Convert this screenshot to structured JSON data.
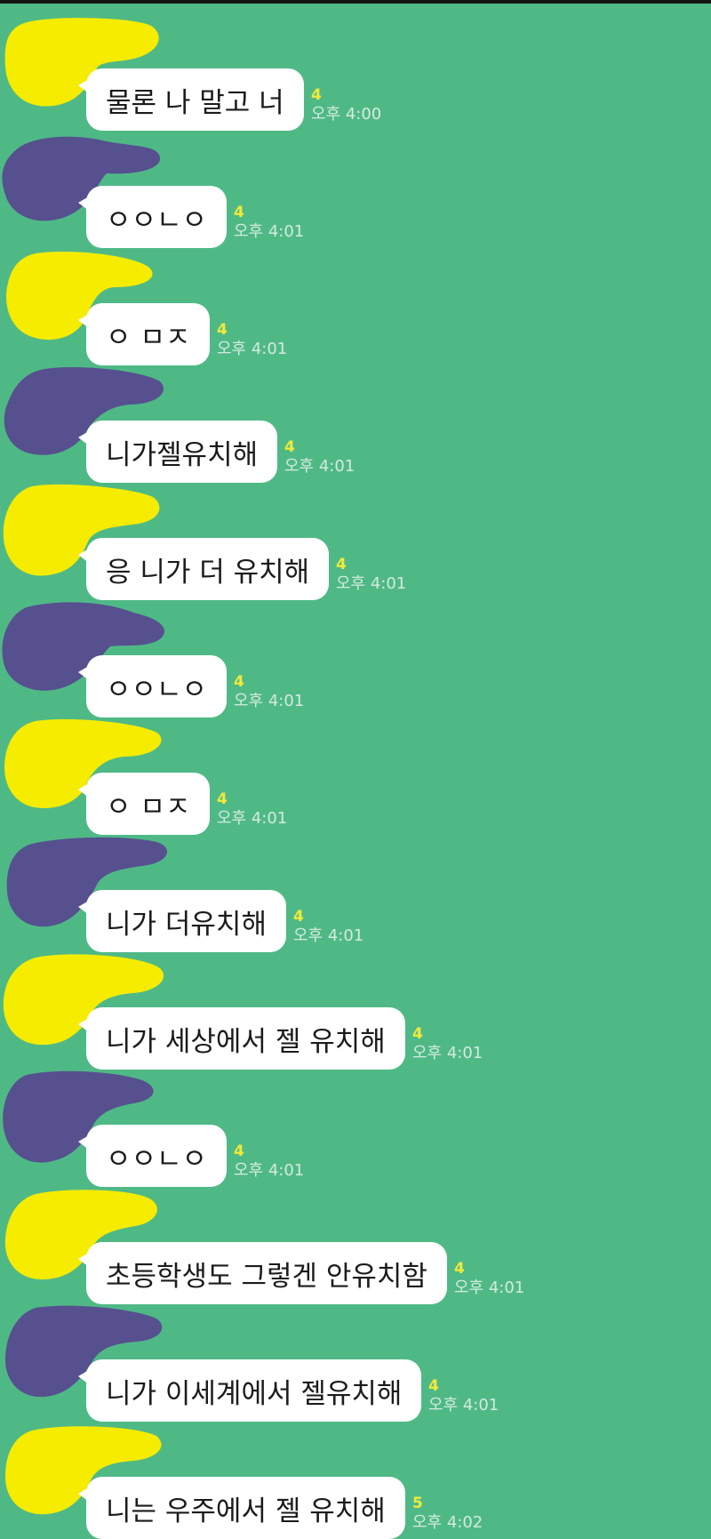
{
  "colors": {
    "background": "#4fb986",
    "bubble": "#ffffff",
    "unread_count": "#f2e93a",
    "avatar_yellow": "#f5ec00",
    "avatar_purple": "#56508f"
  },
  "messages": [
    {
      "avatar": "yellow-blob-avatar",
      "text": "물론 나 말고 너",
      "unread": "4",
      "time": "오후 4:00"
    },
    {
      "avatar": "purple-blob-avatar",
      "text": "ㅇㅇㄴㅇ",
      "unread": "4",
      "time": "오후 4:01"
    },
    {
      "avatar": "yellow-blob-avatar",
      "text": "ㅇ ㅁㅈ",
      "unread": "4",
      "time": "오후 4:01"
    },
    {
      "avatar": "purple-blob-avatar",
      "text": "니가젤유치해",
      "unread": "4",
      "time": "오후 4:01"
    },
    {
      "avatar": "yellow-blob-avatar",
      "text": "응 니가 더 유치해",
      "unread": "4",
      "time": "오후 4:01"
    },
    {
      "avatar": "purple-blob-avatar",
      "text": "ㅇㅇㄴㅇ",
      "unread": "4",
      "time": "오후 4:01"
    },
    {
      "avatar": "yellow-blob-avatar",
      "text": "ㅇ ㅁㅈ",
      "unread": "4",
      "time": "오후 4:01"
    },
    {
      "avatar": "purple-blob-avatar",
      "text": "니가 더유치해",
      "unread": "4",
      "time": "오후 4:01"
    },
    {
      "avatar": "yellow-blob-avatar",
      "text": "니가 세상에서 젤 유치해",
      "unread": "4",
      "time": "오후 4:01"
    },
    {
      "avatar": "purple-blob-avatar",
      "text": "ㅇㅇㄴㅇ",
      "unread": "4",
      "time": "오후 4:01"
    },
    {
      "avatar": "yellow-blob-avatar",
      "text": "초등학생도 그렇겐 안유치함",
      "unread": "4",
      "time": "오후 4:01"
    },
    {
      "avatar": "purple-blob-avatar",
      "text": "니가 이세계에서 젤유치해",
      "unread": "4",
      "time": "오후 4:01"
    },
    {
      "avatar": "yellow-blob-avatar",
      "text": "니는 우주에서 젤 유치해",
      "unread": "5",
      "time": "오후 4:02"
    }
  ]
}
